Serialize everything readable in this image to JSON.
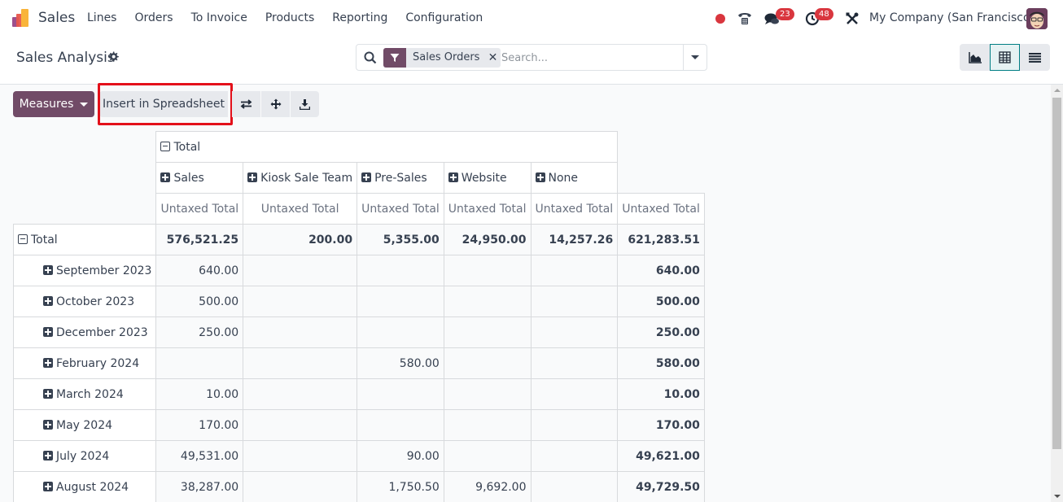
{
  "navbar": {
    "app_name": "Sales",
    "menu": [
      "Lines",
      "Orders",
      "To Invoice",
      "Products",
      "Reporting",
      "Configuration"
    ],
    "chat_badge": "23",
    "activity_badge": "48",
    "company": "My Company (San Francisco)"
  },
  "control": {
    "title": "Sales Analysis",
    "search": {
      "facet_label": "Sales Orders",
      "facet_remove": "✕",
      "placeholder": "Search...",
      "value": ""
    },
    "views": [
      {
        "name": "graph",
        "active": false
      },
      {
        "name": "pivot",
        "active": true
      },
      {
        "name": "list",
        "active": false
      }
    ]
  },
  "toolbar": {
    "measures_label": "Measures",
    "insert_label": "Insert in Spreadsheet"
  },
  "pivot": {
    "col_total_label": "Total",
    "col_groups": [
      "Sales",
      "Kiosk Sale Team",
      "Pre-Sales",
      "Website",
      "None"
    ],
    "measure_label": "Untaxed Total",
    "row_total_label": "Total",
    "total_row": [
      "576,521.25",
      "200.00",
      "5,355.00",
      "24,950.00",
      "14,257.26",
      "621,283.51"
    ],
    "rows": [
      {
        "label": "September 2023",
        "values": [
          "640.00",
          "",
          "",
          "",
          "",
          "640.00"
        ]
      },
      {
        "label": "October 2023",
        "values": [
          "500.00",
          "",
          "",
          "",
          "",
          "500.00"
        ]
      },
      {
        "label": "December 2023",
        "values": [
          "250.00",
          "",
          "",
          "",
          "",
          "250.00"
        ]
      },
      {
        "label": "February 2024",
        "values": [
          "",
          "",
          "580.00",
          "",
          "",
          "580.00"
        ]
      },
      {
        "label": "March 2024",
        "values": [
          "10.00",
          "",
          "",
          "",
          "",
          "10.00"
        ]
      },
      {
        "label": "May 2024",
        "values": [
          "170.00",
          "",
          "",
          "",
          "",
          "170.00"
        ]
      },
      {
        "label": "July 2024",
        "values": [
          "49,531.00",
          "",
          "90.00",
          "",
          "",
          "49,621.00"
        ]
      },
      {
        "label": "August 2024",
        "values": [
          "38,287.00",
          "",
          "1,750.50",
          "9,692.00",
          "",
          "49,729.50"
        ]
      }
    ]
  },
  "colors": {
    "brand": "#714b67",
    "highlight": "#e3101a",
    "badge": "#d9363e",
    "active_view": "#017e84"
  }
}
